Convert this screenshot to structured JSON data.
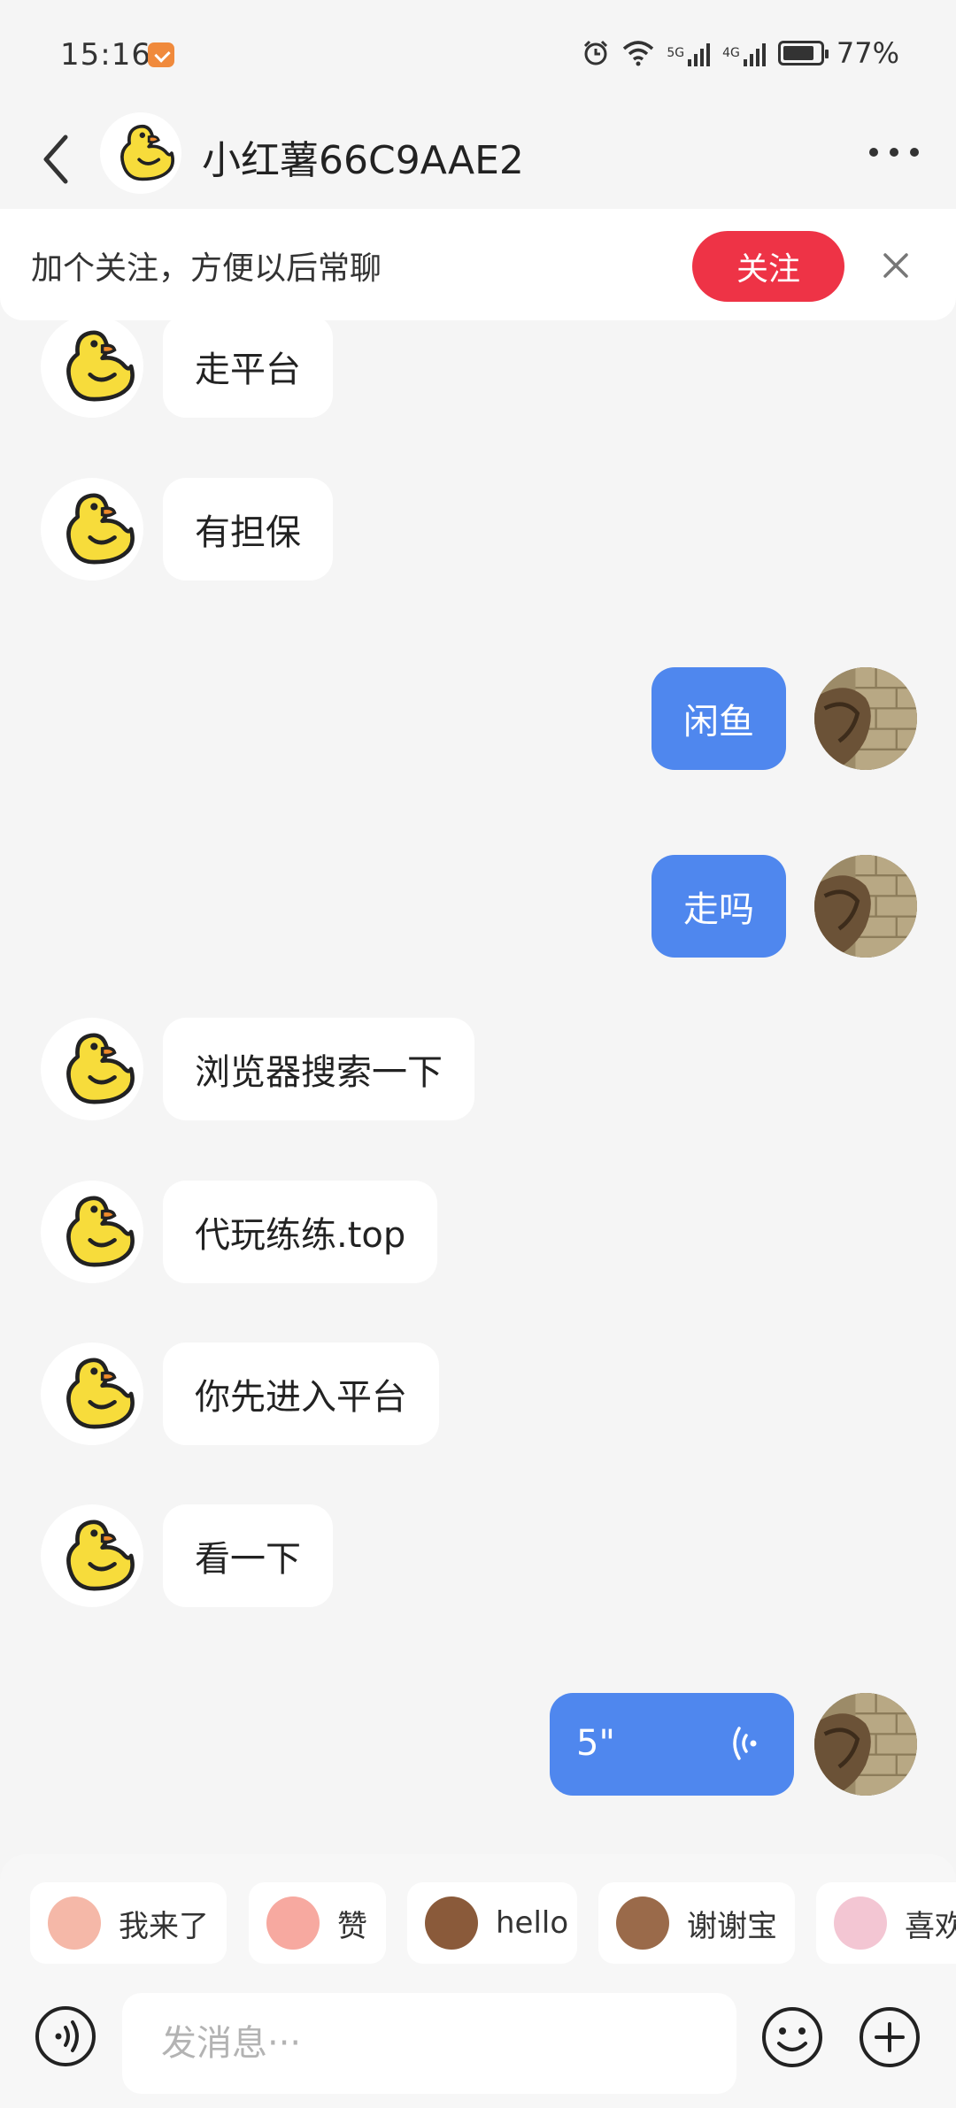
{
  "status_bar": {
    "time": "15:16",
    "battery_level": "77%",
    "net_1": "5G",
    "net_2": "4G"
  },
  "header": {
    "back_icon": "chevron-left-icon",
    "title": "小红薯66C9AAE2",
    "more_icon": "more-dots-icon"
  },
  "follow_banner": {
    "text": "加个关注，方便以后常聊",
    "button_label": "关注",
    "button_color": "#ee3346",
    "close_icon": "close-icon"
  },
  "messages": [
    {
      "side": "in",
      "text": "走平台"
    },
    {
      "side": "in",
      "text": "有担保"
    },
    {
      "side": "out",
      "text": "闲鱼"
    },
    {
      "side": "out",
      "text": "走吗"
    },
    {
      "side": "in",
      "text": "浏览器搜索一下"
    },
    {
      "side": "in",
      "text": "代玩练练.top"
    },
    {
      "side": "in",
      "text": "你先进入平台"
    },
    {
      "side": "in",
      "text": "看一下"
    },
    {
      "side": "out",
      "type": "voice",
      "text": "5\""
    }
  ],
  "quick_replies": [
    "我来了",
    "赞",
    "hello",
    "谢谢宝",
    "喜欢"
  ],
  "input_bar": {
    "placeholder": "发消息···",
    "voice_icon": "voice-icon",
    "emoji_icon": "emoji-icon",
    "plus_icon": "plus-icon"
  },
  "colors": {
    "outgoing_bubble": "#4f87ee",
    "incoming_bubble": "#ffffff",
    "background": "#f5f5f5"
  }
}
